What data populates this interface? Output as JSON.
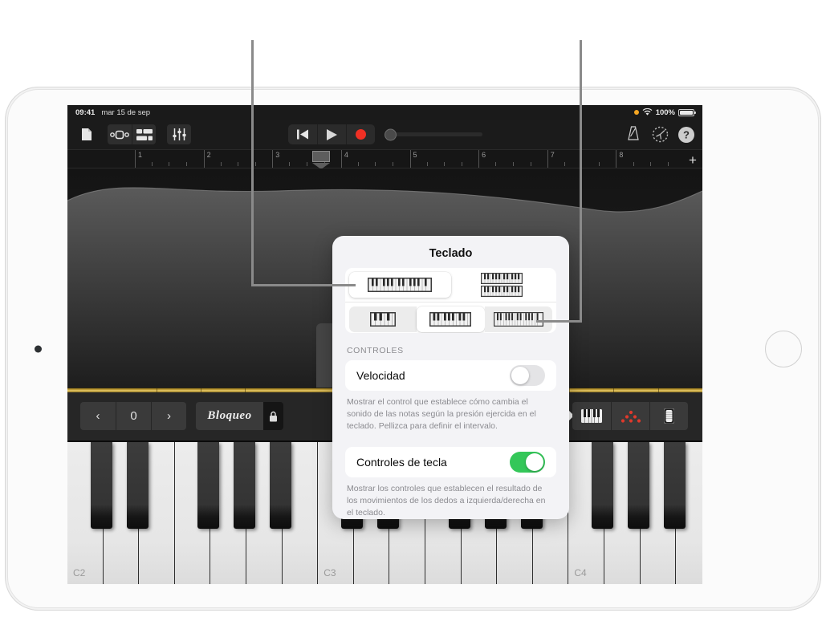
{
  "status_bar": {
    "time": "09:41",
    "date": "mar 15 de sep",
    "battery_percent": "100%",
    "wifi_icon": "wifi-icon",
    "orange_dot_icon": "microphone-in-use-indicator"
  },
  "toolbar": {
    "left_icons": [
      {
        "name": "document-icon",
        "label": "Documentos"
      },
      {
        "name": "view-toggle-icon",
        "label": "Vista"
      },
      {
        "name": "track-list-icon",
        "label": "Pistas"
      },
      {
        "name": "mixer-icon",
        "label": "Controles"
      }
    ],
    "transport": [
      {
        "name": "rewind-button",
        "label": "Ir al inicio"
      },
      {
        "name": "play-button",
        "label": "Reproducir"
      },
      {
        "name": "record-button",
        "label": "Grabar"
      }
    ],
    "master_volume_label": "Volumen principal",
    "right_icons": [
      {
        "name": "metronome-icon",
        "label": "Metrónomo"
      },
      {
        "name": "settings-icon",
        "label": "Ajustes"
      },
      {
        "name": "help-icon",
        "label": "Ayuda"
      }
    ]
  },
  "ruler": {
    "bars": [
      "1",
      "2",
      "3",
      "4",
      "5",
      "6",
      "7",
      "8"
    ],
    "add_section_label": "+",
    "playhead_bar": "3.5"
  },
  "instrument": {
    "name": "Piano de cola",
    "octave_value": "0",
    "prev_label": "‹",
    "next_label": "›",
    "lock_label": "Bloqueo",
    "lock_icon": "lock-icon",
    "right_buttons": [
      {
        "name": "keyboard-view-icon",
        "label": "Teclado"
      },
      {
        "name": "chords-view-icon",
        "label": "Acordes"
      },
      {
        "name": "wheel-view-icon",
        "label": "Ruedas"
      }
    ]
  },
  "keyboard": {
    "octave_labels": [
      "C2",
      "C3",
      "C4"
    ]
  },
  "popover": {
    "title": "Teclado",
    "rows_segment": {
      "name": "keyboard-rows-selector",
      "options": [
        {
          "name": "single-row-keyboard-option",
          "label": "Una fila",
          "selected": true
        },
        {
          "name": "double-row-keyboard-option",
          "label": "Dos filas",
          "selected": false
        }
      ]
    },
    "size_segment": {
      "name": "keyboard-size-selector",
      "options": [
        {
          "name": "large-keys-option",
          "label": "Teclas grandes",
          "selected": false
        },
        {
          "name": "medium-keys-option",
          "label": "Teclas medianas",
          "selected": true
        },
        {
          "name": "small-keys-option",
          "label": "Teclas pequeñas",
          "selected": false
        }
      ]
    },
    "section_label": "CONTROLES",
    "settings": [
      {
        "name": "velocity-setting",
        "label": "Velocidad",
        "enabled": false,
        "help": "Mostrar el control que establece cómo cambia el sonido de las notas según la presión ejercida en el teclado. Pellizca para definir el intervalo."
      },
      {
        "name": "key-controls-setting",
        "label": "Controles de tecla",
        "enabled": true,
        "help": "Mostrar los controles que establecen el resultado de los movimientos de los dedos a izquierda/derecha en el teclado."
      }
    ]
  },
  "colors": {
    "accent_green": "#34c759",
    "record_red": "#f03024",
    "gold": "#c7a23a",
    "callout": "#8a8a8a"
  }
}
